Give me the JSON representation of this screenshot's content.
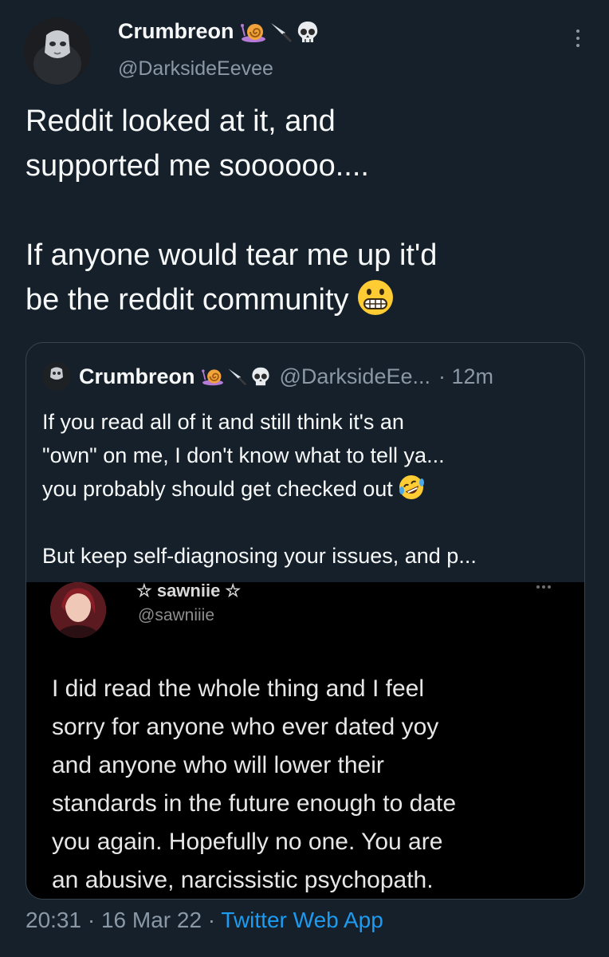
{
  "tweet": {
    "author": {
      "name": "Crumbreon",
      "emojis": [
        "snail-emoji",
        "knife-emoji",
        "skull-emoji"
      ],
      "handle": "@DarksideEevee"
    },
    "text": {
      "line1": "Reddit looked at it, and",
      "line2": "supported me soooooo....",
      "line3": "If anyone would tear me up it'd",
      "line4": "be the reddit community"
    },
    "text_emoji": "grimacing-face-emoji",
    "timestamp": "20:31 · 16 Mar 22 · ",
    "source": "Twitter Web App"
  },
  "quote": {
    "name": "Crumbreon",
    "handle": "@DarksideEe...",
    "time": "· 12m",
    "text": {
      "line1": "If you read all of it and still think it's an",
      "line2": "\"own\" on me, I don't know what to tell ya...",
      "line3": "you probably should get checked out",
      "line4": "But keep self-diagnosing your issues, and p..."
    },
    "text_emoji": "rolling-on-floor-laughing-emoji",
    "image": {
      "name": "☆ sawniie ☆",
      "handle": "@sawniiie",
      "text": {
        "line1": "I did read the whole thing and I feel",
        "line2": "sorry for anyone who ever dated yoy",
        "line3": "and anyone who will lower their",
        "line4": "standards in the future enough to date",
        "line5": "you again. Hopefully no one. You are",
        "line6": "an abusive, narcissistic psychopath."
      }
    }
  },
  "colors": {
    "background": "#15202b",
    "text": "#f7f9f9",
    "secondary": "#8b98a5",
    "link": "#1d9bf0",
    "border": "#38444d"
  }
}
